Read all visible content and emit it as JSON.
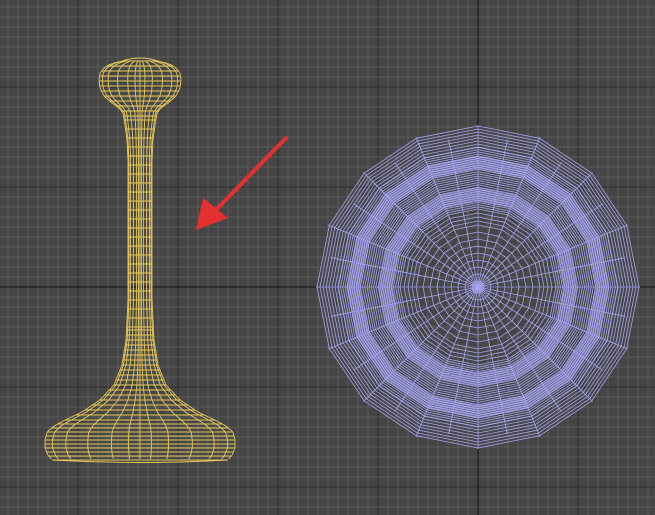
{
  "viewport": {
    "background": "#454545",
    "grid_minor_color": "#5a5a5a",
    "grid_major_color": "#303030",
    "axis_color": "#111111"
  },
  "objects": [
    {
      "name": "lathe-profile-mesh",
      "view": "front",
      "wire_color": "#e8c95a"
    },
    {
      "name": "lathe-top-mesh",
      "view": "top",
      "wire_color": "#a6a4f0",
      "radial_segments": 16
    }
  ],
  "annotation": {
    "icon": "red-arrow-icon",
    "color": "#e53030"
  }
}
